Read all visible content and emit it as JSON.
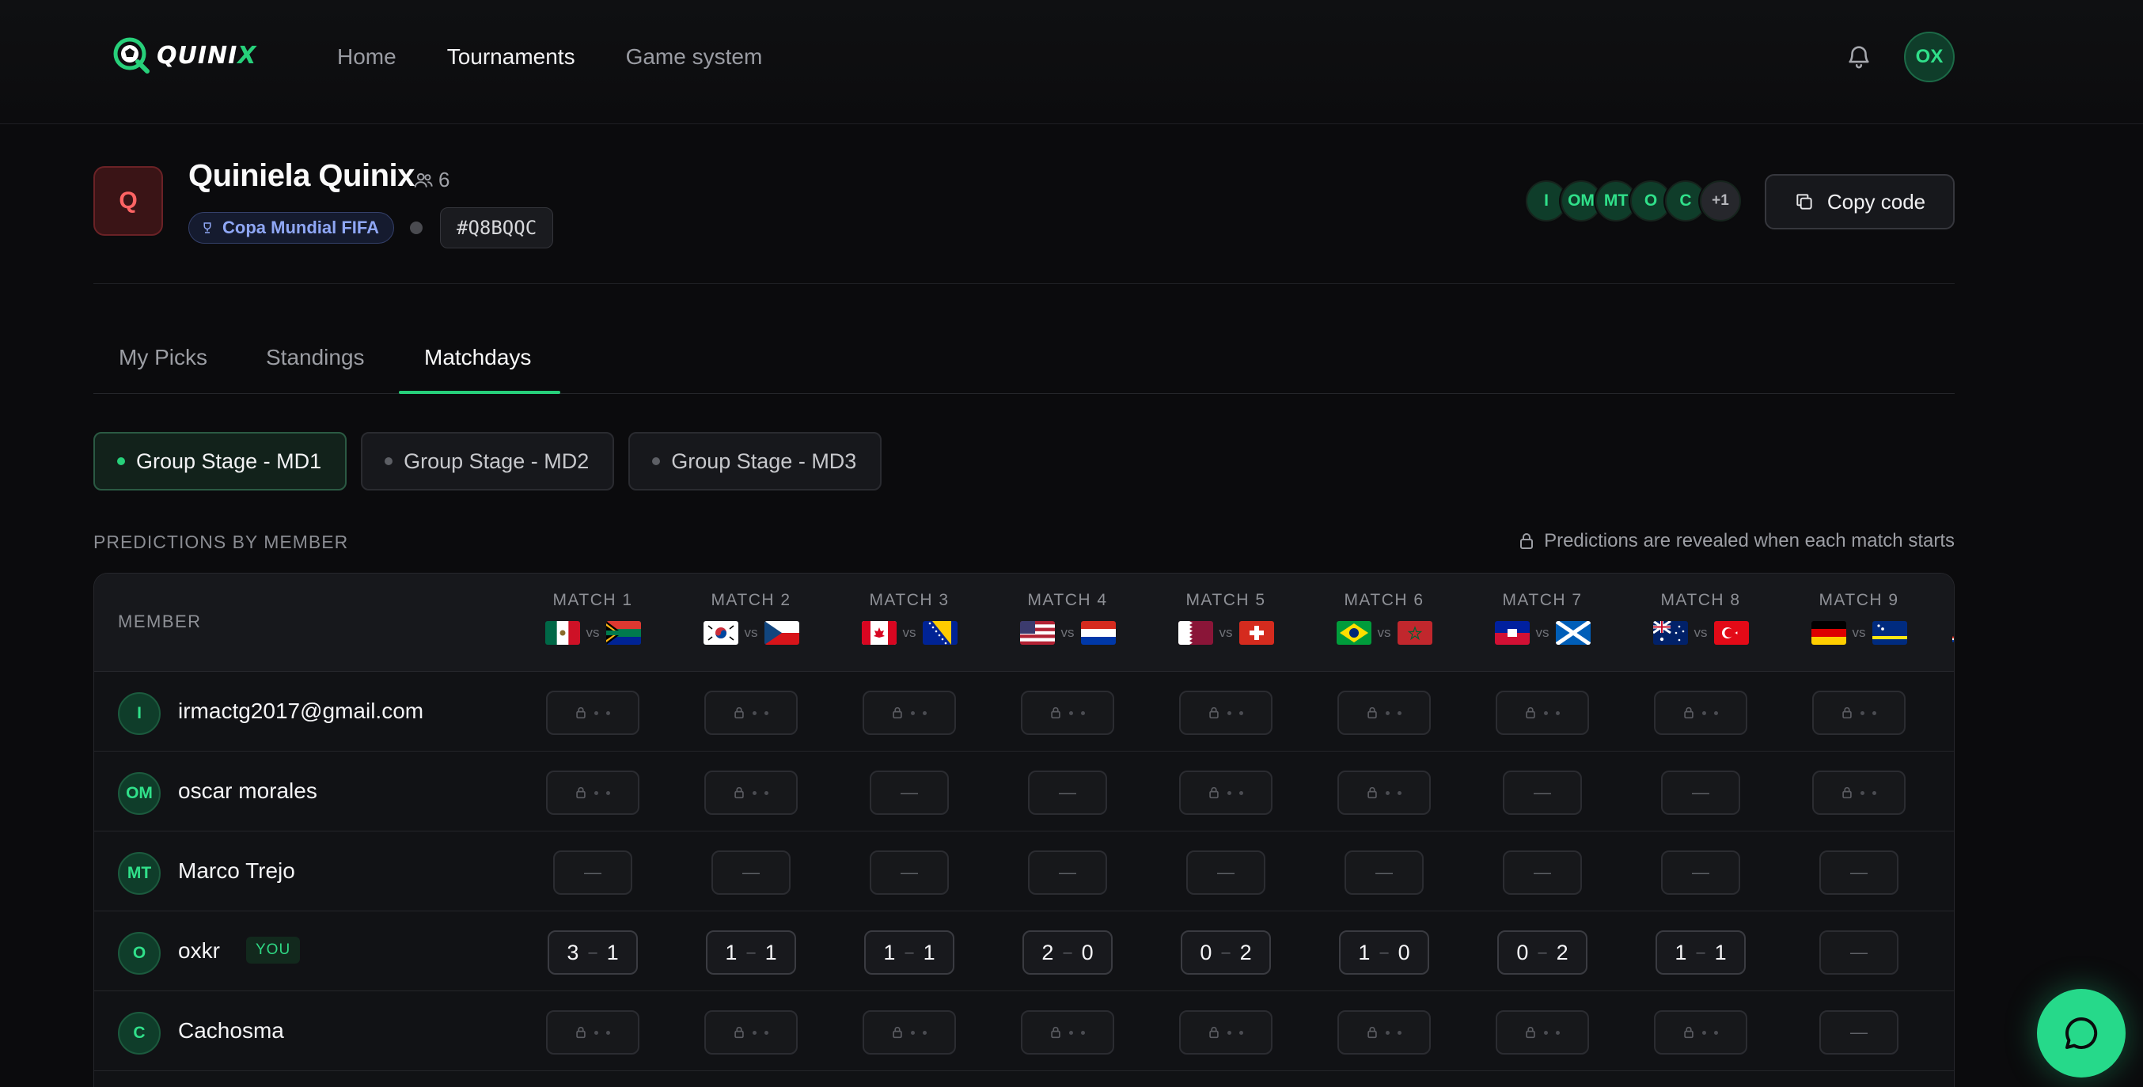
{
  "app": {
    "brand": "QUINI",
    "brand_accent": "X"
  },
  "nav": {
    "links": [
      "Home",
      "Tournaments",
      "Game system"
    ],
    "active": "Tournaments",
    "user_initials": "OX"
  },
  "pool": {
    "icon_letter": "Q",
    "title": "Quiniela Quinix",
    "member_count": "6",
    "league": "Copa Mundial FIFA",
    "code": "#Q8BQQC",
    "member_avatars": [
      "I",
      "OM",
      "MT",
      "O",
      "C"
    ],
    "more_members": "+1",
    "copy_label": "Copy code"
  },
  "tabs": {
    "items": [
      "My Picks",
      "Standings",
      "Matchdays"
    ],
    "active": "Matchdays"
  },
  "matchdays": {
    "items": [
      "Group Stage - MD1",
      "Group Stage - MD2",
      "Group Stage - MD3"
    ],
    "active": "Group Stage - MD1"
  },
  "predictions": {
    "section_label": "PREDICTIONS BY MEMBER",
    "reveal_note": "Predictions are revealed when each match starts",
    "member_header": "MEMBER",
    "vs_label": "vs",
    "you_label": "YOU",
    "empty_label": "—",
    "matches": [
      {
        "label": "MATCH 1",
        "home": "mexico",
        "away": "south-africa"
      },
      {
        "label": "MATCH 2",
        "home": "south-korea",
        "away": "czechia"
      },
      {
        "label": "MATCH 3",
        "home": "canada",
        "away": "bosnia"
      },
      {
        "label": "MATCH 4",
        "home": "usa",
        "away": "paraguay"
      },
      {
        "label": "MATCH 5",
        "home": "qatar",
        "away": "switzerland"
      },
      {
        "label": "MATCH 6",
        "home": "brazil",
        "away": "morocco"
      },
      {
        "label": "MATCH 7",
        "home": "haiti",
        "away": "scotland"
      },
      {
        "label": "MATCH 8",
        "home": "australia",
        "away": "turkey"
      },
      {
        "label": "MATCH 9",
        "home": "germany",
        "away": "curacao"
      }
    ],
    "rows": [
      {
        "initials": "I",
        "name": "irmactg2017@gmail.com",
        "is_you": false,
        "cells": [
          "locked",
          "locked",
          "locked",
          "locked",
          "locked",
          "locked",
          "locked",
          "locked",
          "locked"
        ]
      },
      {
        "initials": "OM",
        "name": "oscar morales",
        "is_you": false,
        "cells": [
          "locked",
          "locked",
          "empty",
          "empty",
          "locked",
          "locked",
          "empty",
          "empty",
          "locked"
        ]
      },
      {
        "initials": "MT",
        "name": "Marco Trejo",
        "is_you": false,
        "cells": [
          "empty",
          "empty",
          "empty",
          "empty",
          "empty",
          "empty",
          "empty",
          "empty",
          "empty"
        ]
      },
      {
        "initials": "O",
        "name": "oxkr",
        "is_you": true,
        "cells": [
          [
            "3",
            "1"
          ],
          [
            "1",
            "1"
          ],
          [
            "1",
            "1"
          ],
          [
            "2",
            "0"
          ],
          [
            "0",
            "2"
          ],
          [
            "1",
            "0"
          ],
          [
            "0",
            "2"
          ],
          [
            "1",
            "1"
          ],
          "empty"
        ]
      },
      {
        "initials": "C",
        "name": "Cachosma",
        "is_you": false,
        "cells": [
          "locked",
          "locked",
          "locked",
          "locked",
          "locked",
          "locked",
          "locked",
          "locked",
          "empty"
        ]
      }
    ]
  },
  "colors": {
    "accent": "#27d07a",
    "league_badge": "#8fa7f5",
    "pool_icon": "#ff6464"
  }
}
